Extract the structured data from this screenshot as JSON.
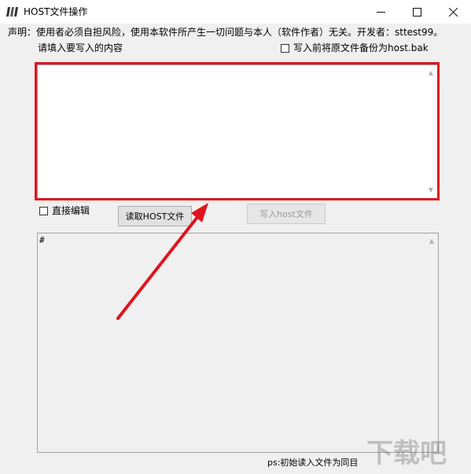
{
  "window": {
    "title": "HOST文件操作",
    "minimize_icon": "minimize-icon",
    "maximize_icon": "maximize-icon",
    "close_icon": "close-icon"
  },
  "disclaimer": "声明：使用者必须自担风险，使用本软件所产生一切问题与本人（软件作者）无关。开发者：sttest99。",
  "input_section": {
    "label": "请填入要写入的内容",
    "backup_checkbox_label": "写入前将原文件备份为host.bak",
    "backup_checked": false,
    "content": ""
  },
  "controls": {
    "direct_edit_label": "直接编辑",
    "direct_edit_checked": false,
    "read_button": "读取HOST文件",
    "write_button": "写入host文件",
    "write_button_disabled": true
  },
  "output": {
    "content": "#"
  },
  "footer": {
    "ps_text": "ps:初始读入文件为同目"
  },
  "annotation": {
    "highlight_color": "#e0141e",
    "arrow_color": "#e0141e"
  },
  "watermark": {
    "text": "下载吧"
  }
}
